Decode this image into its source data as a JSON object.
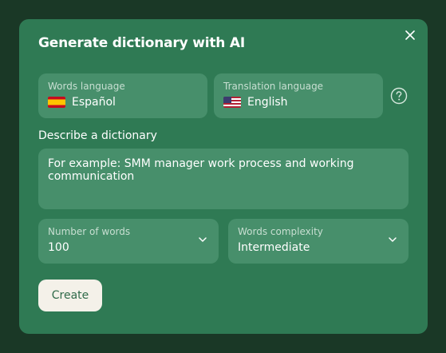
{
  "dialog": {
    "title": "Generate dictionary with AI",
    "close_icon": "close-icon",
    "help_icon": "question-circle-icon"
  },
  "words_language": {
    "label": "Words language",
    "value": "Español",
    "flag_icon": "flag-spain-icon"
  },
  "translation_language": {
    "label": "Translation language",
    "value": "English",
    "flag_icon": "flag-usa-icon"
  },
  "describe": {
    "label": "Describe a dictionary",
    "placeholder": "For example: SMM manager work process and working communication"
  },
  "number_of_words": {
    "label": "Number of words",
    "value": "100"
  },
  "words_complexity": {
    "label": "Words complexity",
    "value": "Intermediate"
  },
  "create_label": "Create",
  "colors": {
    "background": "#1a3826",
    "dialog": "#2f7a54",
    "field": "#478f6b",
    "button": "#f4f1e9",
    "button_text": "#2f6a49"
  }
}
